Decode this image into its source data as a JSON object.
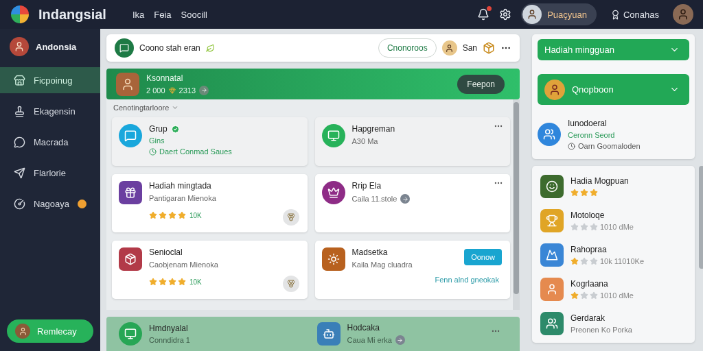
{
  "header": {
    "logo": "Indangsial",
    "nav": [
      "Ika",
      "Fɵia",
      "Soocill"
    ],
    "notifications": {
      "unread": true
    },
    "user_pill": "Puaçyuan",
    "achievements": "Conahas"
  },
  "sidebar": {
    "profile": "Andonsia",
    "items": [
      {
        "label": "Ficpoinug",
        "selected": true,
        "badge": false
      },
      {
        "label": "Ekagensin",
        "selected": false,
        "badge": false
      },
      {
        "label": "Macrada",
        "selected": false,
        "badge": false
      },
      {
        "label": "Flarlorie",
        "selected": false,
        "badge": false
      },
      {
        "label": "Nagoaya",
        "selected": false,
        "badge": true
      }
    ],
    "bottom_button": "Remlecay"
  },
  "composer": {
    "text": "Coono stah eran",
    "button": "Cnonoroos",
    "user": "San"
  },
  "banner": {
    "name": "Ksonnatal",
    "stats": "2 000",
    "points": "2313",
    "button": "Feepon"
  },
  "feed": {
    "filter": "Cenotingtarloore",
    "cards": [
      {
        "kind": "group",
        "title": "Grup",
        "verified": true,
        "subtitle": "Gins",
        "meta": "Daert Conmad Saues"
      },
      {
        "kind": "app",
        "title": "Hapgreman",
        "subtitle": "A30 Ma",
        "arrow": false
      },
      {
        "kind": "rated",
        "title": "Hadiah mingtada",
        "subtitle": "Pantigaran Mienoka",
        "stars": 4,
        "count": "10K"
      },
      {
        "kind": "app",
        "title": "Rrip Ela",
        "subtitle": "Caila 11.stole",
        "arrow": true
      },
      {
        "kind": "rated",
        "title": "Senioclal",
        "subtitle": "Caobjenam Mienoka",
        "stars": 4,
        "count": "10K"
      },
      {
        "kind": "action",
        "title": "Madsetka",
        "subtitle": "Kaila Mag cluadra",
        "button": "Oonow",
        "link": "Fenn alnd gneokak"
      }
    ]
  },
  "bottom_cards": [
    {
      "title": "Hmdnyalal",
      "subtitle": "Conndidra 1",
      "arrow": false
    },
    {
      "title": "Hodcaka",
      "subtitle": "Caua Mi erka",
      "arrow": true
    }
  ],
  "rewards": {
    "dropdowns": [
      "Hadiah mingguan",
      "Qnopboon"
    ],
    "group": {
      "title": "Iunodoeral",
      "subtitle": "Ceronn Seord",
      "meta": "Oarn Goomaloden"
    }
  },
  "leaderboard": [
    {
      "kind": "rated",
      "name": "Hadia Mogpuan",
      "stars": 3
    },
    {
      "kind": "rated",
      "name": "Motoloqe",
      "stars": 0,
      "count": "1010 dMe"
    },
    {
      "kind": "rated",
      "name": "Rahopraa",
      "stars": 1,
      "count": "10k  11010Ke"
    },
    {
      "kind": "rated",
      "name": "Kogrlaana",
      "stars": 1,
      "count": "1010 dMe"
    },
    {
      "kind": "text",
      "name": "Gerdarak",
      "subtitle": "Preonen Ko Porka"
    }
  ]
}
